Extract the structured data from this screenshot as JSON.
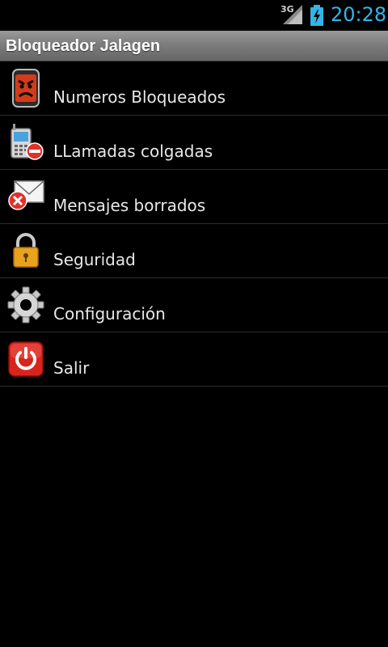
{
  "status_bar": {
    "network": "3G",
    "time": "20:28",
    "signal_icon": "signal-icon",
    "battery_icon": "battery-charging-icon",
    "time_color": "#33b5e5"
  },
  "title_bar": {
    "title": "Bloqueador Jalagen"
  },
  "menu": {
    "items": [
      {
        "label": "Numeros Bloqueados",
        "icon": "angry-phone-icon"
      },
      {
        "label": "LLamadas colgadas",
        "icon": "phone-blocked-icon"
      },
      {
        "label": "Mensajes borrados",
        "icon": "envelope-delete-icon"
      },
      {
        "label": "Seguridad",
        "icon": "padlock-icon"
      },
      {
        "label": "Configuración",
        "icon": "gear-icon"
      },
      {
        "label": "Salir",
        "icon": "power-icon"
      }
    ]
  }
}
